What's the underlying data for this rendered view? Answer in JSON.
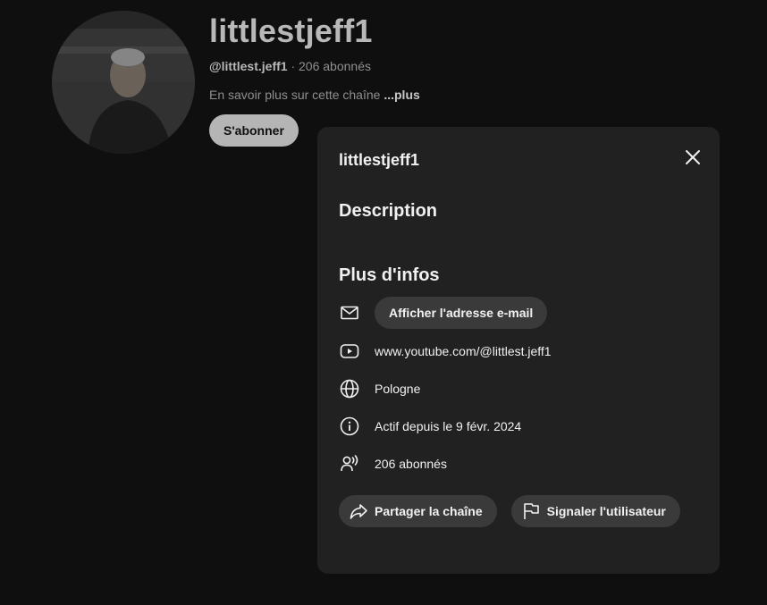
{
  "channel": {
    "name": "littlestjeff1",
    "handle": "@littlest.jeff1",
    "separator": " · ",
    "subscribers_short": "206 abonnés",
    "about_teaser": "En savoir plus sur cette chaîne",
    "more_label": "...plus",
    "subscribe_label": "S'abonner"
  },
  "modal": {
    "title": "littlestjeff1",
    "description_heading": "Description",
    "more_info_heading": "Plus d'infos",
    "email_button": "Afficher l'adresse e-mail",
    "url": "www.youtube.com/@littlest.jeff1",
    "country": "Pologne",
    "joined": "Actif depuis le 9 févr. 2024",
    "subscribers": "206 abonnés",
    "share_button": "Partager la chaîne",
    "report_button": "Signaler l'utilisateur"
  },
  "icons": {
    "close": "close-icon",
    "email": "mail-icon",
    "url": "youtube-icon",
    "country": "globe-icon",
    "joined": "info-icon",
    "subscribers": "subscribers-icon",
    "share": "share-icon",
    "report": "flag-icon"
  },
  "colors": {
    "background": "#0f0f0f",
    "modal_bg": "#212121",
    "pill_bg": "#3a3a3a",
    "text": "#f1f1f1",
    "muted_text": "#8f8f8f"
  }
}
